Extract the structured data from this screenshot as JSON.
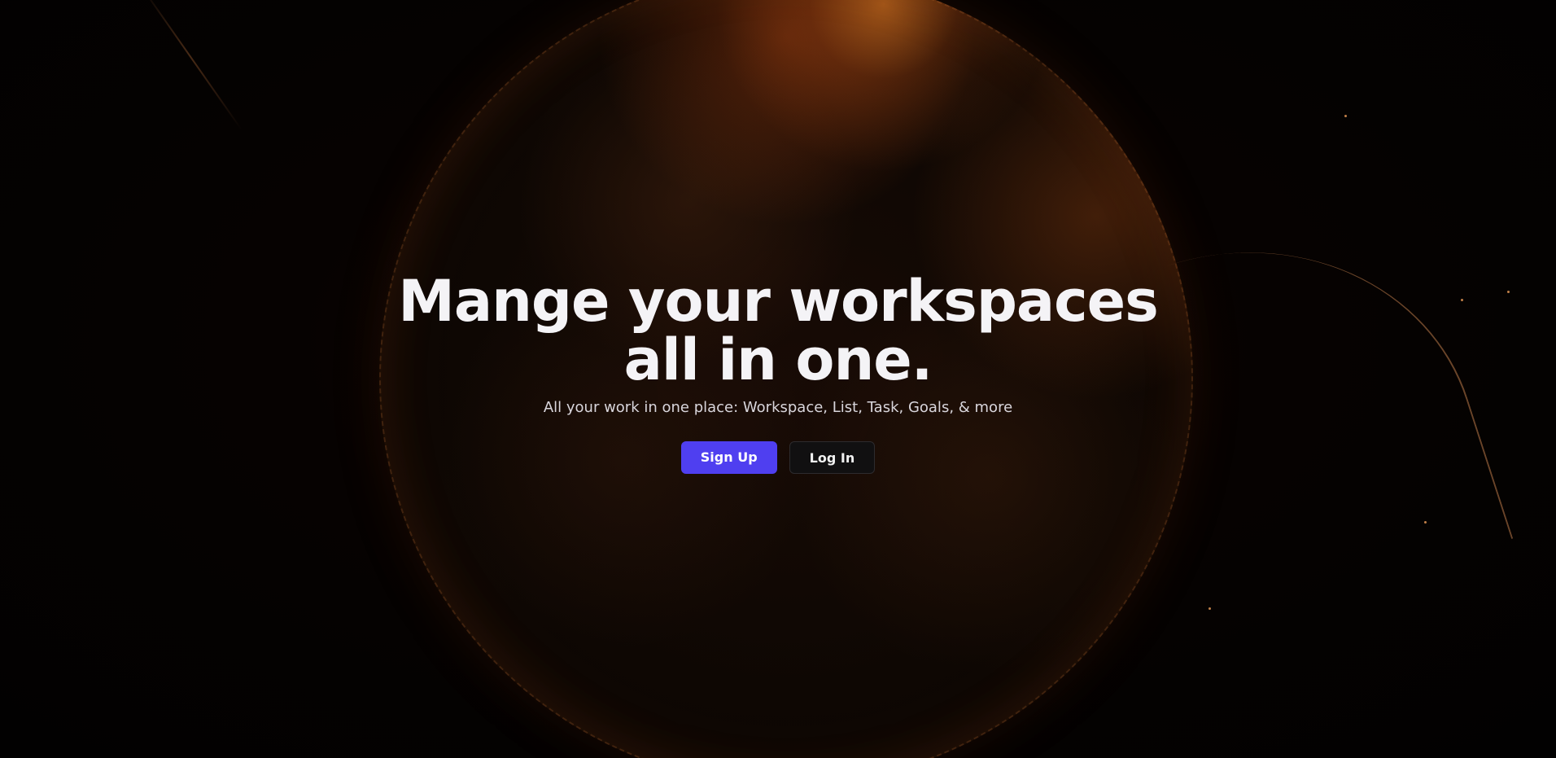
{
  "hero": {
    "title": "Mange your workspaces all in one.",
    "subtitle": "All your work in one place: Workspace, List, Task, Goals, & more"
  },
  "actions": {
    "signup_label": "Sign Up",
    "login_label": "Log In"
  },
  "colors": {
    "primary_button": "#4f3ff0",
    "secondary_button": "#111011",
    "background": "#030101",
    "globe_glow": "#ff8c28"
  },
  "background": {
    "image": "globe-illustration"
  }
}
